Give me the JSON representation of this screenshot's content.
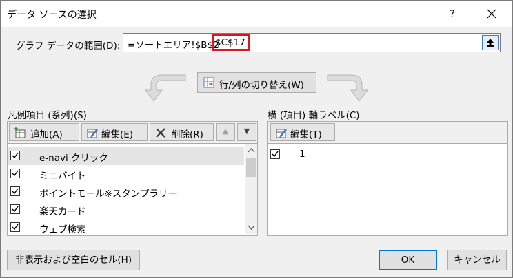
{
  "window": {
    "title": "データ ソースの選択",
    "help": "?",
    "close": "×"
  },
  "range": {
    "label": "グラフ データの範囲(D):",
    "value_plain": "=ソートエリア!$B$2",
    "value_highlight": "$C$17"
  },
  "switch_button": {
    "label": "行/列の切り替え(W)"
  },
  "series": {
    "title": "凡例項目 (系列)(S)",
    "toolbar": {
      "add": "追加(A)",
      "edit": "編集(E)",
      "delete": "削除(R)",
      "up": "▲",
      "down": "▼"
    },
    "items": [
      {
        "label": "e-navi クリック",
        "checked": true
      },
      {
        "label": "ミニバイト",
        "checked": true
      },
      {
        "label": "ポイントモール※スタンプラリー",
        "checked": true
      },
      {
        "label": "楽天カード",
        "checked": true
      },
      {
        "label": "ウェブ検索",
        "checked": true
      }
    ]
  },
  "axis": {
    "title": "横 (項目) 軸ラベル(C)",
    "toolbar": {
      "edit": "編集(T)"
    },
    "items": [
      {
        "label": "1",
        "checked": true
      }
    ]
  },
  "footer": {
    "hidden_cells": "非表示および空白のセル(H)",
    "ok": "OK",
    "cancel": "キャンセル"
  },
  "colors": {
    "highlight": "#e0141e",
    "selection": "#e5e5e5",
    "accent": "#0078d7"
  }
}
